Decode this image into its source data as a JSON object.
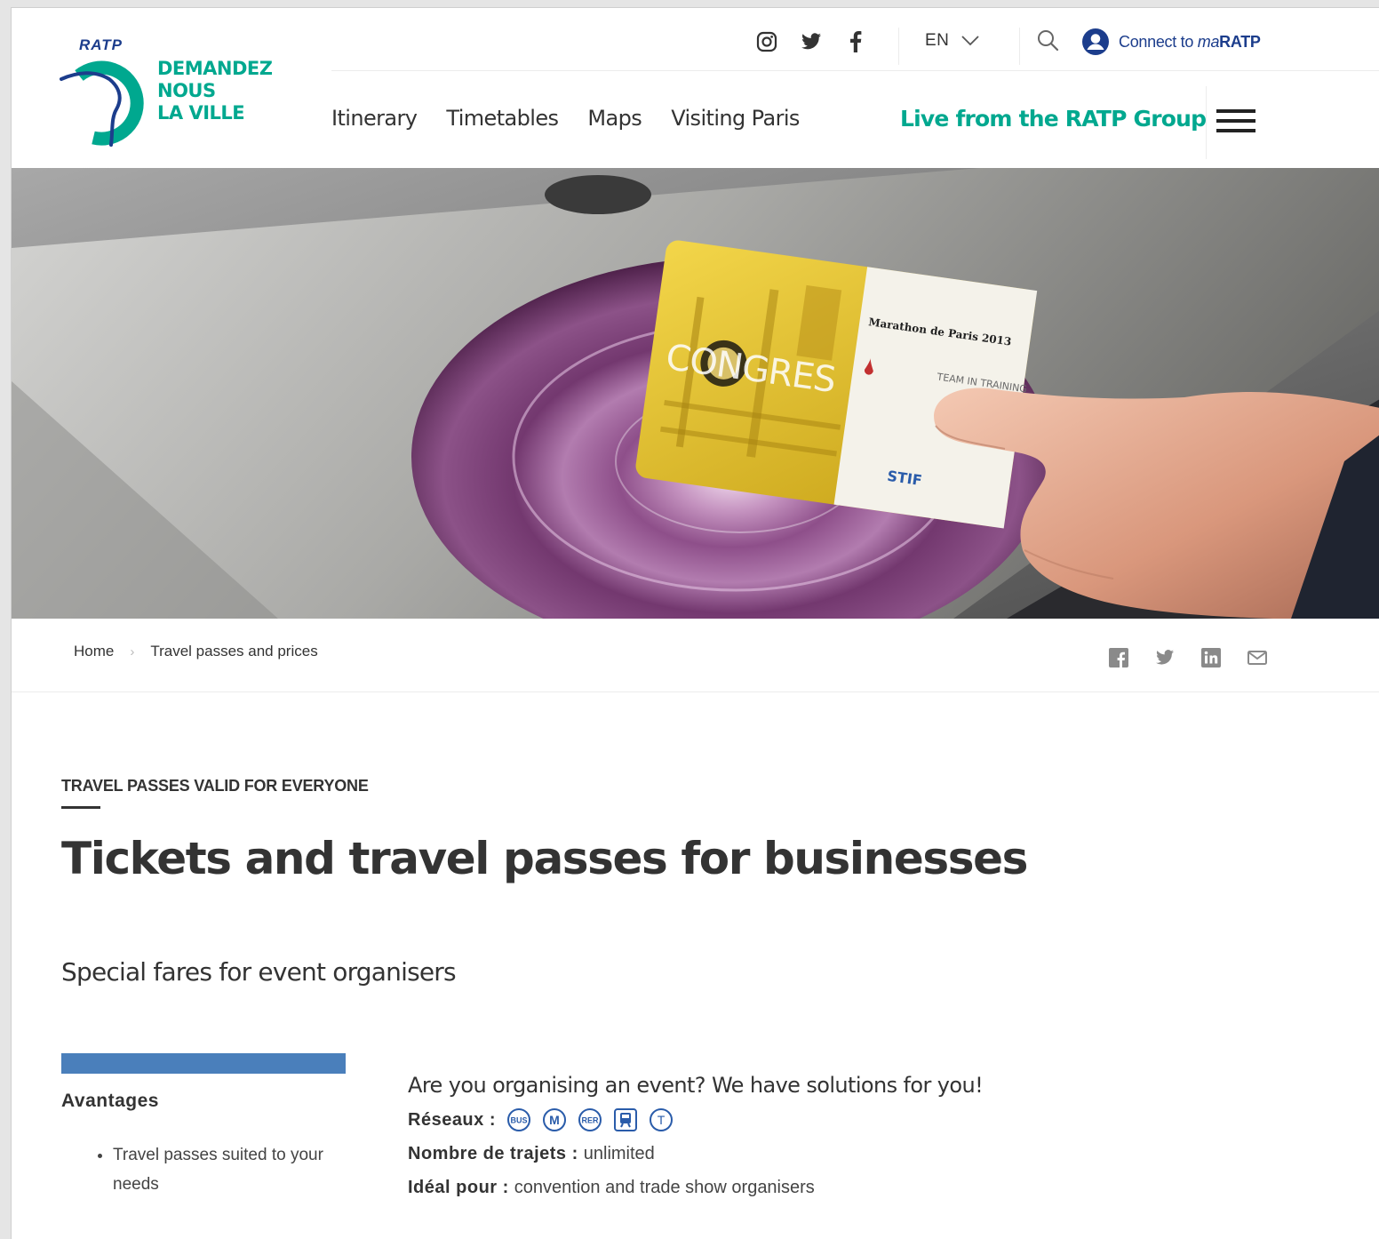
{
  "brand": {
    "logo_text": "RATP",
    "tagline": [
      "DEMANDEZ",
      "NOUS",
      "LA VILLE"
    ]
  },
  "header": {
    "language": "EN",
    "connect": {
      "prefix": "Connect to ",
      "ma": "ma",
      "brand": "RATP"
    },
    "nav": [
      {
        "label": "Itinerary"
      },
      {
        "label": "Timetables"
      },
      {
        "label": "Maps"
      },
      {
        "label": "Visiting Paris"
      }
    ],
    "live_link": "Live from the RATP Group"
  },
  "hero": {
    "card_title": "CONGRES",
    "card_event": "Marathon de Paris 2013",
    "card_team": "TEAM IN TRAINING",
    "card_logo": "STIF"
  },
  "breadcrumb": {
    "home": "Home",
    "current": "Travel passes and prices"
  },
  "content": {
    "eyebrow": "TRAVEL PASSES VALID FOR EVERYONE",
    "title": "Tickets and travel passes for businesses",
    "subtitle": "Special fares for event organisers",
    "advantages": {
      "title": "Avantages",
      "items": [
        "Travel passes suited to your needs"
      ]
    },
    "info": {
      "heading": "Are you organising an event? We have solutions for you!",
      "networks_label": "Réseaux :",
      "networks": [
        {
          "label": "BUS"
        },
        {
          "label": "M"
        },
        {
          "label": "RER"
        },
        {
          "label": "Tram"
        },
        {
          "label": "T"
        }
      ],
      "trips_label": "Nombre de trajets :",
      "trips_value": " unlimited",
      "ideal_label": "Idéal pour :",
      "ideal_value": " convention and trade show organisers"
    }
  },
  "colors": {
    "brand_green": "#00a88f",
    "brand_blue": "#1c3d8c",
    "network_blue": "#2a5caa",
    "advantages_bar": "#4a7fbb"
  }
}
